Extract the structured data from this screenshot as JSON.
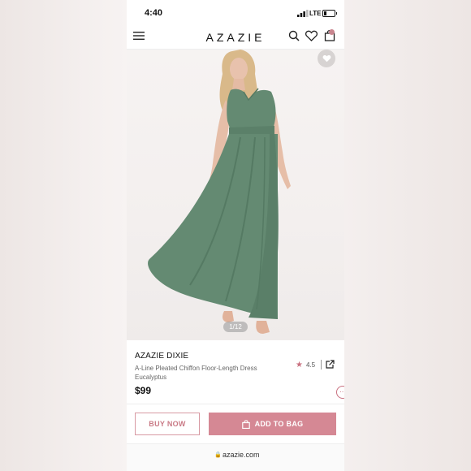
{
  "status_bar": {
    "time": "4:40",
    "network": "LTE"
  },
  "header": {
    "logo": "AZAZIE"
  },
  "gallery": {
    "counter": "1/12"
  },
  "product": {
    "brand_name": "AZAZIE DIXIE",
    "description_line1": "A-Line Pleated Chiffon Floor-Length Dress",
    "description_line2": "Eucalyptus",
    "price": "$99",
    "rating": "4.5"
  },
  "actions": {
    "buy_now": "BUY NOW",
    "add_to_bag": "ADD TO BAG"
  },
  "browser": {
    "url": "azazie.com"
  },
  "colors": {
    "accent": "#d58894",
    "dress": "#648a72"
  }
}
